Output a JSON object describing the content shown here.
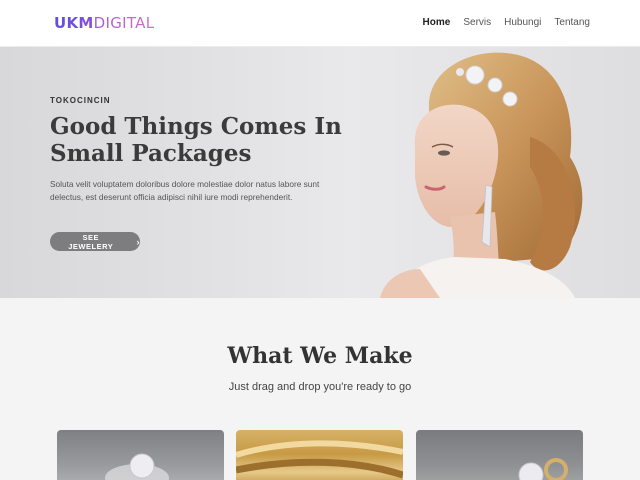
{
  "navbar": {
    "brand_bold": "UKM",
    "brand_light": "DIGITAL",
    "links": [
      "Home",
      "Servis",
      "Hubungi",
      "Tentang"
    ],
    "active_link": "Home"
  },
  "hero": {
    "eyebrow": "TOKOCINCIN",
    "title": "Good Things Comes In Small Packages",
    "text": "Soluta velit voluptatem doloribus dolore molestiae dolor natus labore sunt delectus, est deserunt officia adipisci nihil iure modi reprehenderit.",
    "button_label": "SEE JEWELERY",
    "button_icon": "chevron-right-icon"
  },
  "section": {
    "title": "What We Make",
    "subtitle": "Just drag and drop you're ready to go"
  },
  "cards": [
    {
      "name": "card-ring-diamond"
    },
    {
      "name": "card-gold-bands"
    },
    {
      "name": "card-ring-set"
    }
  ],
  "colors": {
    "brand_start": "#5b4fe0",
    "brand_end": "#d06fc0",
    "button_bg": "#7d7d80",
    "text_dark": "#3b3b3b"
  }
}
